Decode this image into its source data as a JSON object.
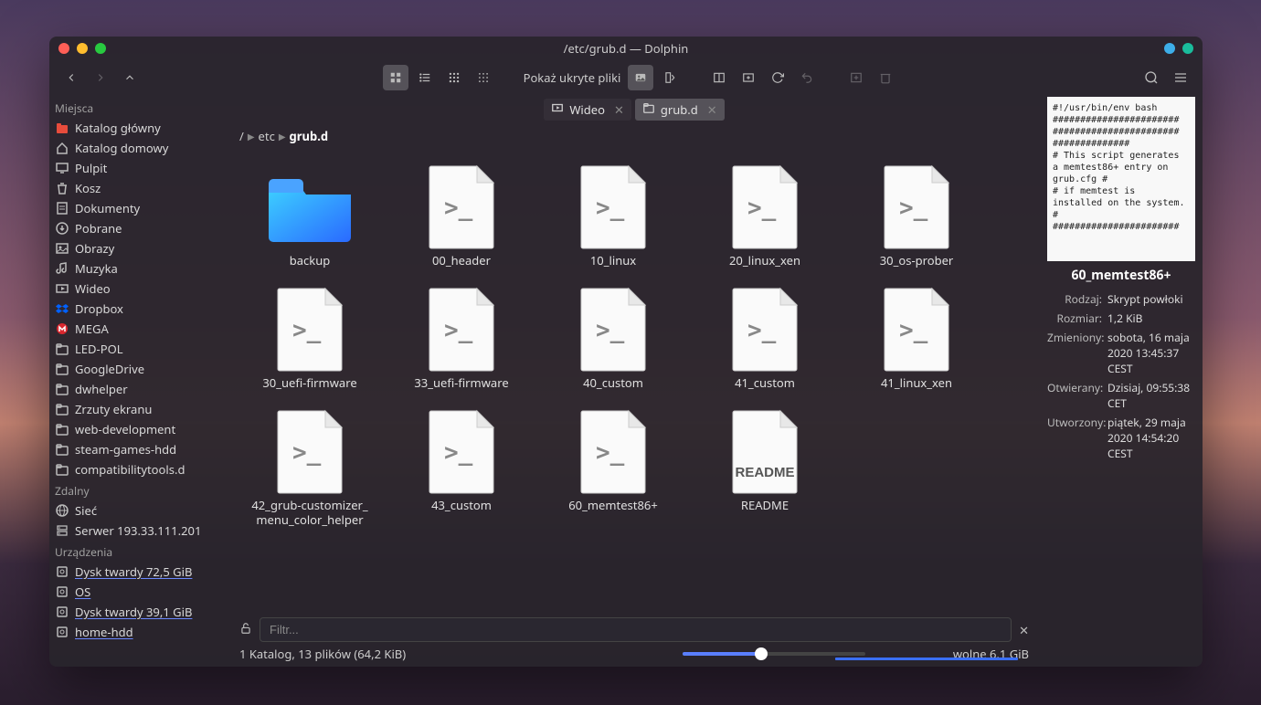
{
  "window_title": "/etc/grub.d — Dolphin",
  "toolbar": {
    "hidden_label": "Pokaż ukryte pliki"
  },
  "tabs": [
    {
      "label": "Wideo",
      "active": false
    },
    {
      "label": "grub.d",
      "active": true
    }
  ],
  "breadcrumb": [
    "/",
    "etc",
    "grub.d"
  ],
  "sidebar": {
    "groups": [
      {
        "header": "Miejsca",
        "items": [
          {
            "icon": "folder-red",
            "label": "Katalog główny"
          },
          {
            "icon": "home",
            "label": "Katalog domowy"
          },
          {
            "icon": "desktop",
            "label": "Pulpit"
          },
          {
            "icon": "trash",
            "label": "Kosz"
          },
          {
            "icon": "documents",
            "label": "Dokumenty"
          },
          {
            "icon": "download",
            "label": "Pobrane"
          },
          {
            "icon": "pictures",
            "label": "Obrazy"
          },
          {
            "icon": "music",
            "label": "Muzyka"
          },
          {
            "icon": "video",
            "label": "Wideo"
          },
          {
            "icon": "dropbox",
            "label": "Dropbox"
          },
          {
            "icon": "mega",
            "label": "MEGA"
          },
          {
            "icon": "folder",
            "label": "LED-POL"
          },
          {
            "icon": "folder",
            "label": "GoogleDrive"
          },
          {
            "icon": "folder",
            "label": "dwhelper"
          },
          {
            "icon": "folder",
            "label": "Zrzuty ekranu"
          },
          {
            "icon": "folder",
            "label": "web-development"
          },
          {
            "icon": "folder",
            "label": "steam-games-hdd"
          },
          {
            "icon": "folder",
            "label": "compatibilitytools.d"
          }
        ]
      },
      {
        "header": "Zdalny",
        "items": [
          {
            "icon": "network",
            "label": "Sieć"
          },
          {
            "icon": "server",
            "label": "Serwer 193.33.111.201"
          }
        ]
      },
      {
        "header": "Urządzenia",
        "items": [
          {
            "icon": "disk",
            "label": "Dysk twardy 72,5 GiB",
            "underline": true
          },
          {
            "icon": "disk",
            "label": "OS",
            "underline": true
          },
          {
            "icon": "disk",
            "label": "Dysk twardy 39,1 GiB",
            "underline": true
          },
          {
            "icon": "disk",
            "label": "home-hdd",
            "underline": true
          }
        ]
      }
    ]
  },
  "files": [
    {
      "name": "backup",
      "type": "folder"
    },
    {
      "name": "00_header",
      "type": "script"
    },
    {
      "name": "10_linux",
      "type": "script"
    },
    {
      "name": "20_linux_xen",
      "type": "script"
    },
    {
      "name": "30_os-prober",
      "type": "script"
    },
    {
      "name": "30_uefi-firmware",
      "type": "script"
    },
    {
      "name": "33_uefi-firmware",
      "type": "script"
    },
    {
      "name": "40_custom",
      "type": "script"
    },
    {
      "name": "41_custom",
      "type": "script"
    },
    {
      "name": "41_linux_xen",
      "type": "script"
    },
    {
      "name": "42_grub-customizer_ menu_color_helper",
      "type": "script"
    },
    {
      "name": "43_custom",
      "type": "script"
    },
    {
      "name": "60_memtest86+",
      "type": "script"
    },
    {
      "name": "README",
      "type": "readme"
    }
  ],
  "preview": {
    "text": "#!/usr/bin/env bash\n#######################\n#######################\n##############\n# This script generates a memtest86+ entry on grub.cfg #\n# if memtest is installed on the system.\n#\n#######################",
    "name": "60_memtest86+",
    "rows": [
      {
        "key": "Rodzaj:",
        "val": "Skrypt powłoki"
      },
      {
        "key": "Rozmiar:",
        "val": "1,2 KiB"
      },
      {
        "key": "Zmieniony:",
        "val": "sobota, 16 maja 2020 13:45:37 CEST"
      },
      {
        "key": "Otwierany:",
        "val": "Dzisiaj, 09:55:38 CET"
      },
      {
        "key": "Utworzony:",
        "val": "piątek, 29 maja 2020 14:54:20 CEST"
      }
    ]
  },
  "filter_placeholder": "Filtr...",
  "status": "1 Katalog, 13 plików (64,2 KiB)",
  "free_space": "wolne 6,1 GiB"
}
